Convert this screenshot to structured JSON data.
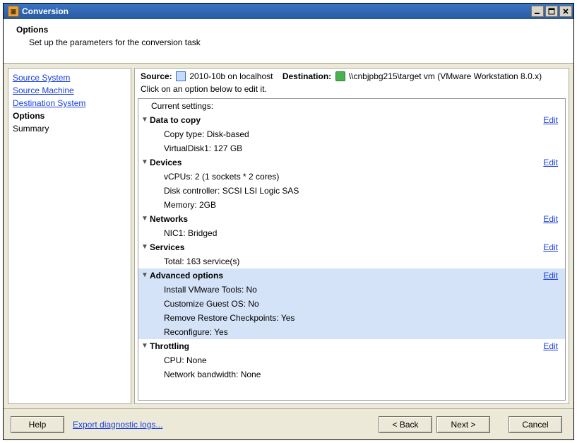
{
  "window": {
    "title": "Conversion"
  },
  "header": {
    "title": "Options",
    "subtitle": "Set up the parameters for the conversion task"
  },
  "nav": {
    "items": [
      {
        "label": "Source System",
        "kind": "link"
      },
      {
        "label": "Source Machine",
        "kind": "link"
      },
      {
        "label": "Destination System",
        "kind": "link"
      },
      {
        "label": "Options",
        "kind": "current"
      },
      {
        "label": "Summary",
        "kind": "plain"
      }
    ]
  },
  "topline": {
    "source_label": "Source:",
    "source_value": "2010-10b on localhost",
    "dest_label": "Destination:",
    "dest_value": "\\\\cnbjpbg215\\target vm (VMware Workstation 8.0.x)"
  },
  "subhint": "Click on an option below to edit it.",
  "settings": {
    "header": "Current settings:",
    "edit": "Edit",
    "sections": [
      {
        "title": "Data to copy",
        "selected": false,
        "items": [
          "Copy type: Disk-based",
          "VirtualDisk1: 127 GB"
        ]
      },
      {
        "title": "Devices",
        "selected": false,
        "items": [
          "vCPUs: 2 (1 sockets * 2 cores)",
          "Disk controller: SCSI LSI Logic SAS",
          "Memory: 2GB"
        ]
      },
      {
        "title": "Networks",
        "selected": false,
        "items": [
          "NIC1: Bridged"
        ]
      },
      {
        "title": "Services",
        "selected": false,
        "items": [
          "Total: 163 service(s)"
        ]
      },
      {
        "title": "Advanced options",
        "selected": true,
        "items": [
          "Install VMware Tools: No",
          "Customize Guest OS: No",
          "Remove Restore Checkpoints: Yes",
          "Reconfigure: Yes"
        ]
      },
      {
        "title": "Throttling",
        "selected": false,
        "items": [
          "CPU: None",
          "Network bandwidth: None"
        ]
      }
    ]
  },
  "footer": {
    "help": "Help",
    "export": "Export diagnostic logs...",
    "back": "< Back",
    "next": "Next >",
    "cancel": "Cancel"
  }
}
